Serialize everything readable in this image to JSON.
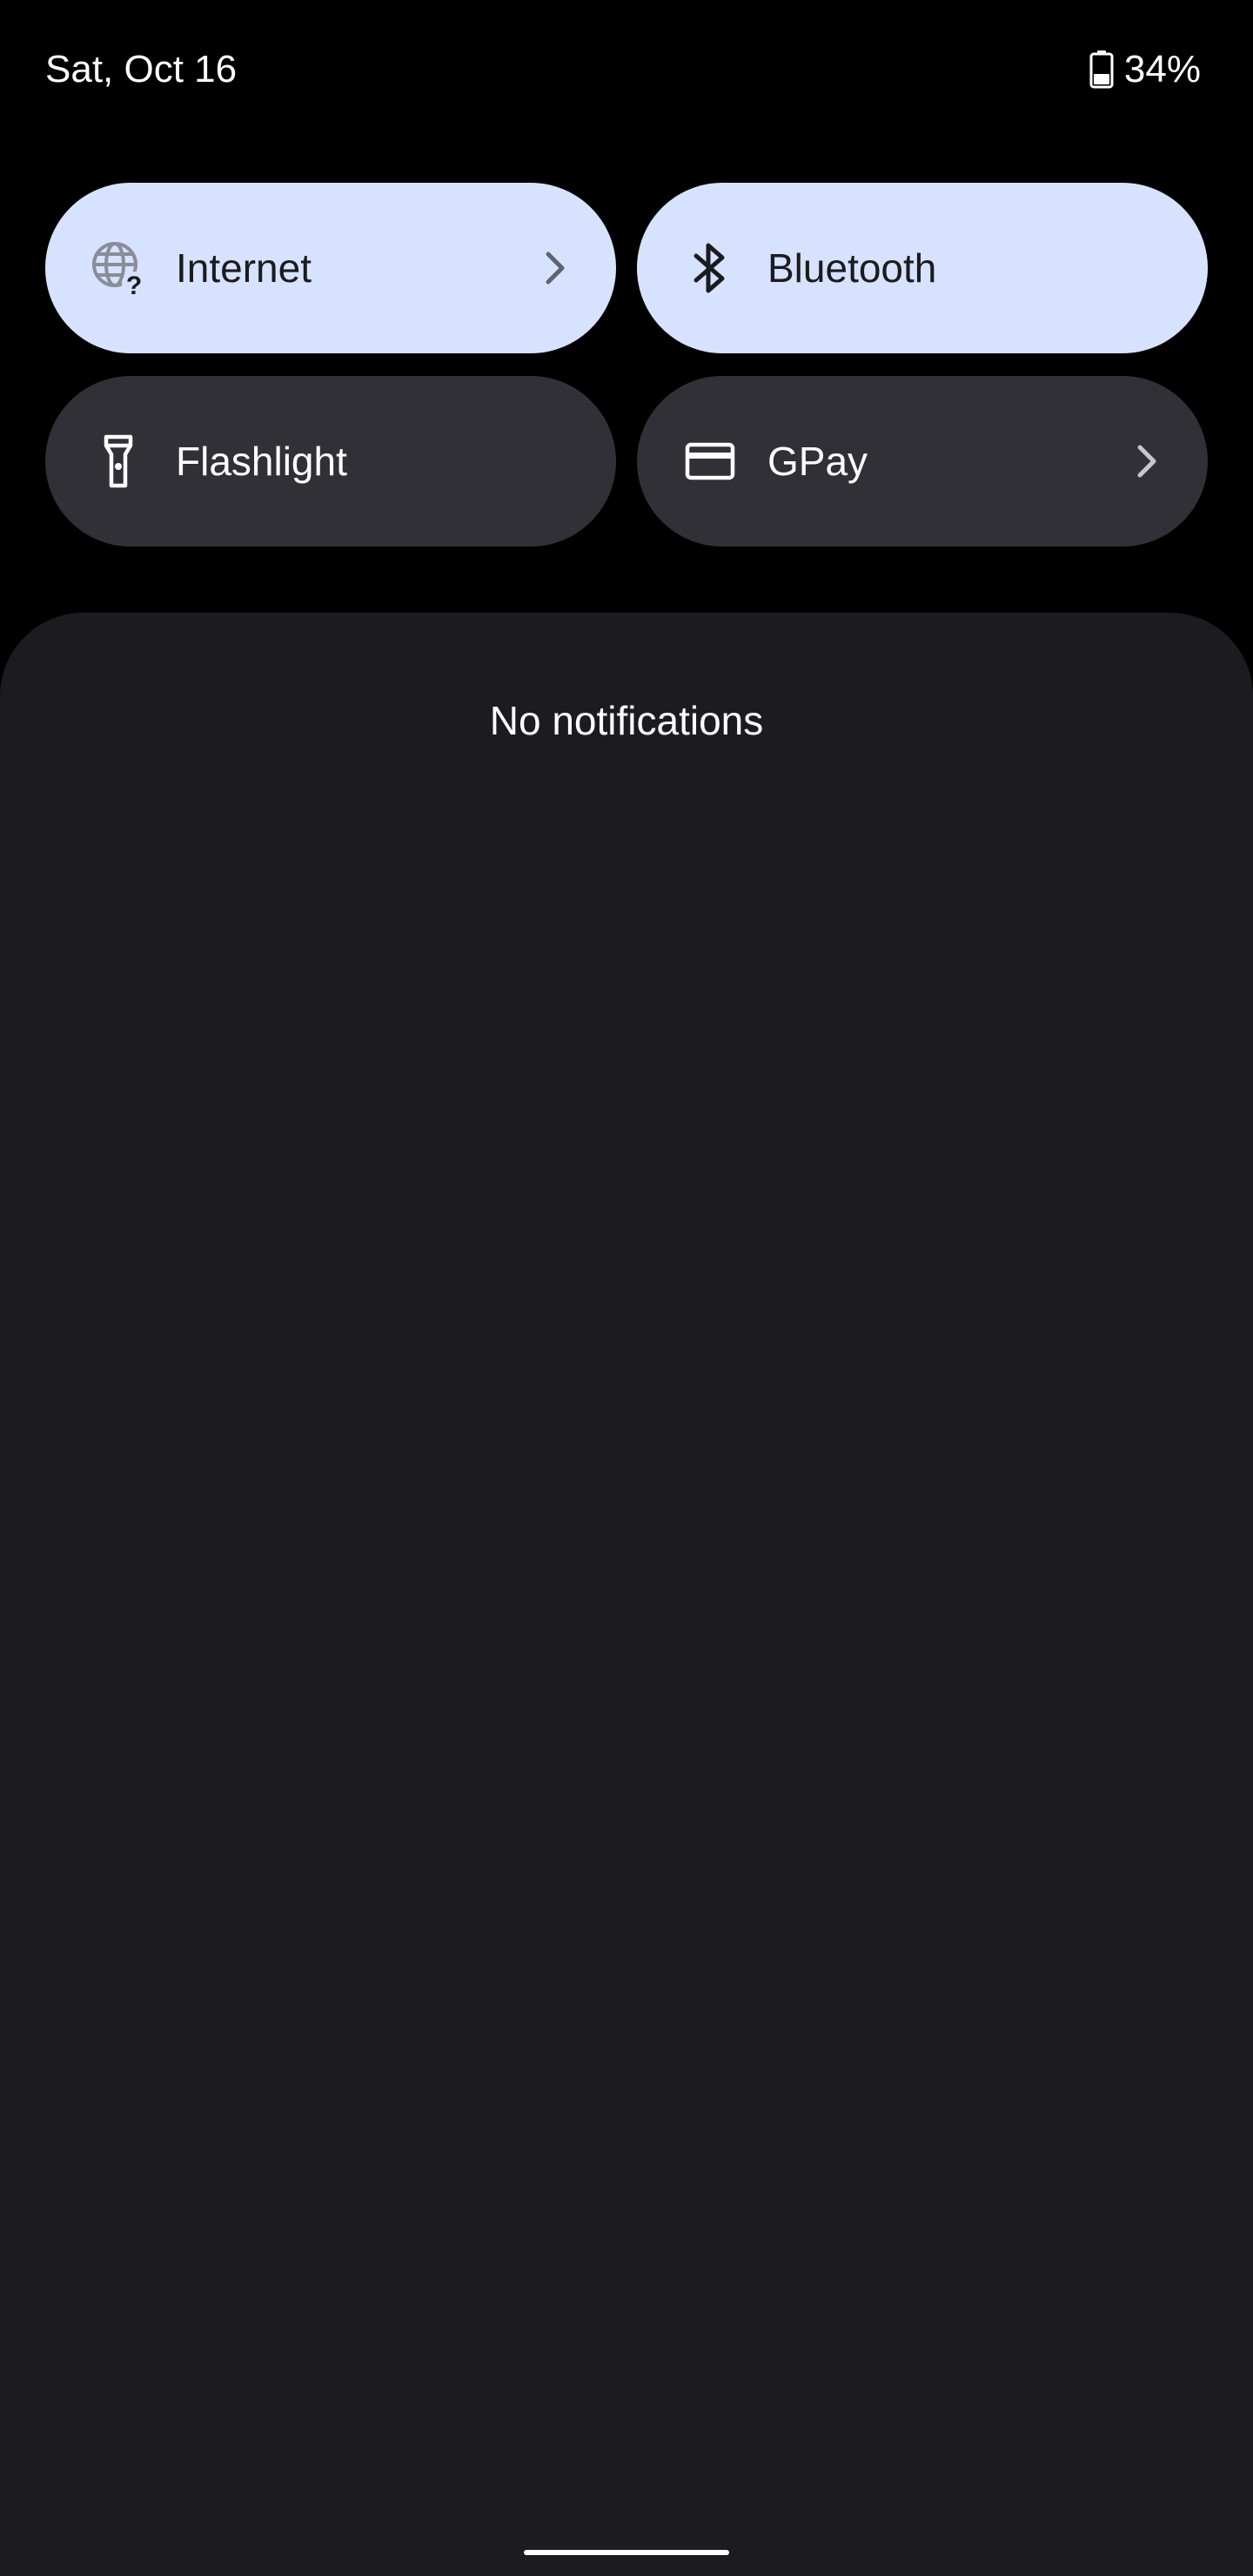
{
  "status_bar": {
    "date": "Sat, Oct 16",
    "battery_percent": "34%",
    "battery_icon": "battery-icon"
  },
  "quick_settings": {
    "tiles": [
      {
        "label": "Internet",
        "icon": "globe-question-icon",
        "active": true,
        "has_chevron": true
      },
      {
        "label": "Bluetooth",
        "icon": "bluetooth-icon",
        "active": true,
        "has_chevron": false
      },
      {
        "label": "Flashlight",
        "icon": "flashlight-icon",
        "active": false,
        "has_chevron": false
      },
      {
        "label": "GPay",
        "icon": "credit-card-icon",
        "active": false,
        "has_chevron": true
      }
    ]
  },
  "notifications": {
    "empty_text": "No notifications"
  },
  "colors": {
    "background": "#000000",
    "tile_active": "#d7e2ff",
    "tile_inactive": "#303036",
    "panel": "#1c1b20",
    "text_on_dark": "#ffffff",
    "text_on_light": "#1b1b1f"
  }
}
